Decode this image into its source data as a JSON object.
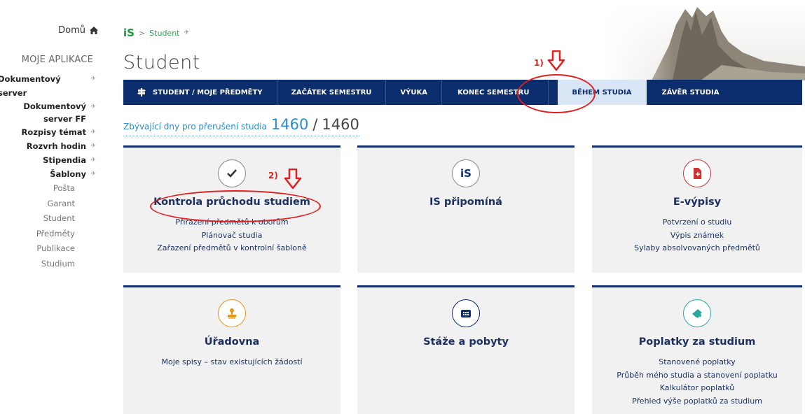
{
  "sidebar": {
    "home": "Domů",
    "heading": "MOJE APLIKACE",
    "pinned": [
      {
        "label": "Dokumentový server"
      },
      {
        "label": "Dokumentový server FF"
      },
      {
        "label": "Rozpisy témat"
      },
      {
        "label": "Rozvrh hodin"
      },
      {
        "label": "Stipendia"
      },
      {
        "label": "Šablony"
      }
    ],
    "plain": [
      "Pošta",
      "Garant",
      "Student",
      "Předměty",
      "Publikace",
      "Studium"
    ]
  },
  "breadcrumb": {
    "logo": "iS",
    "separator": ">",
    "current": "Student"
  },
  "page_title": "Student",
  "nav": {
    "items": [
      {
        "label": "STUDENT / MOJE PŘEDMĚTY"
      },
      {
        "label": "ZAČÁTEK SEMESTRU"
      },
      {
        "label": "VÝUKA"
      },
      {
        "label": "KONEC SEMESTRU"
      },
      {
        "label": "BĚHEM STUDIA"
      },
      {
        "label": "ZÁVĚR STUDIA"
      }
    ],
    "active_index": 4
  },
  "remaining": {
    "label": "Zbývající dny pro přerušení studia",
    "value": "1460",
    "slash": "/",
    "total": "1460"
  },
  "tiles": [
    {
      "title": "Kontrola průchodu studiem",
      "icon": "checkmark-icon",
      "links": [
        "Přiřazení předmětů k oborům",
        "Plánovač studia",
        "Zařazení předmětů v kontrolní šabloně"
      ]
    },
    {
      "title": "IS připomíná",
      "icon": "is-logo-icon",
      "links": []
    },
    {
      "title": "E-výpisy",
      "icon": "document-icon",
      "links": [
        "Potvrzení o studiu",
        "Výpis známek",
        "Sylaby absolvovaných předmětů"
      ]
    },
    {
      "title": "Úřadovna",
      "icon": "stamp-icon",
      "links": [
        "Moje spisy – stav existujících žádostí"
      ]
    },
    {
      "title": "Stáže a pobyty",
      "icon": "building-icon",
      "links": []
    },
    {
      "title": "Poplatky za studium",
      "icon": "payment-icon",
      "links": [
        "Stanovené poplatky",
        "Průběh mého studia a stanovení poplatku",
        "Kalkulátor poplatků",
        "Přehled výše poplatků za studium"
      ]
    }
  ],
  "annotations": {
    "label_1": "1)",
    "label_2": "2)"
  },
  "colors": {
    "nav_bg": "#0b2d6e",
    "nav_active_bg": "#d7e5f4",
    "accent_blue": "#2e8ccf",
    "annotation_red": "#e02020",
    "is_green": "#1a9b3c"
  }
}
